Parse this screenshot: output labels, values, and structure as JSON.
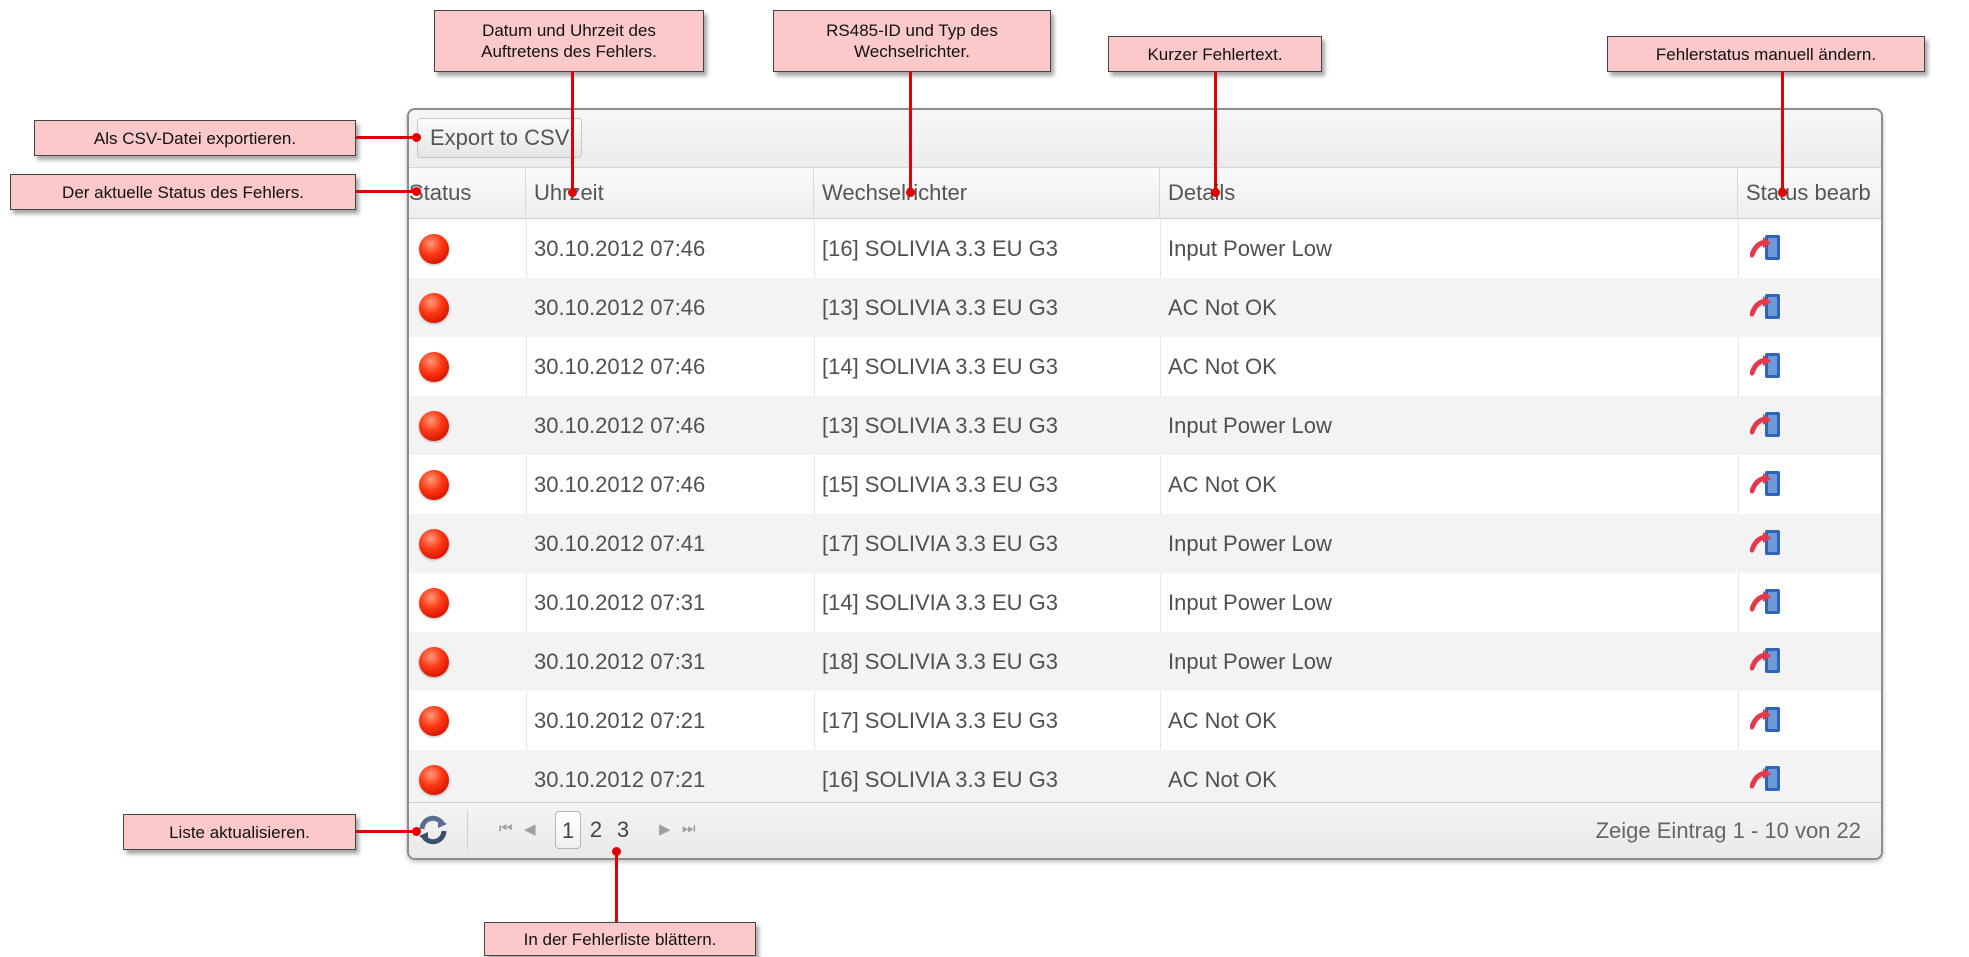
{
  "toolbar": {
    "export_label": "Export to CSV"
  },
  "columns": {
    "status": "Status",
    "time": "Uhrzeit",
    "inverter": "Wechselrichter",
    "details": "Details",
    "edit": "Status bearb"
  },
  "rows": [
    {
      "time": "30.10.2012 07:46",
      "inverter": "[16] SOLIVIA 3.3 EU G3",
      "details": "Input Power Low"
    },
    {
      "time": "30.10.2012 07:46",
      "inverter": "[13] SOLIVIA 3.3 EU G3",
      "details": "AC Not OK"
    },
    {
      "time": "30.10.2012 07:46",
      "inverter": "[14] SOLIVIA 3.3 EU G3",
      "details": "AC Not OK"
    },
    {
      "time": "30.10.2012 07:46",
      "inverter": "[13] SOLIVIA 3.3 EU G3",
      "details": "Input Power Low"
    },
    {
      "time": "30.10.2012 07:46",
      "inverter": "[15] SOLIVIA 3.3 EU G3",
      "details": "AC Not OK"
    },
    {
      "time": "30.10.2012 07:41",
      "inverter": "[17] SOLIVIA 3.3 EU G3",
      "details": "Input Power Low"
    },
    {
      "time": "30.10.2012 07:31",
      "inverter": "[14] SOLIVIA 3.3 EU G3",
      "details": "Input Power Low"
    },
    {
      "time": "30.10.2012 07:31",
      "inverter": "[18] SOLIVIA 3.3 EU G3",
      "details": "Input Power Low"
    },
    {
      "time": "30.10.2012 07:21",
      "inverter": "[17] SOLIVIA 3.3 EU G3",
      "details": "AC Not OK"
    },
    {
      "time": "30.10.2012 07:21",
      "inverter": "[16] SOLIVIA 3.3 EU G3",
      "details": "AC Not OK"
    }
  ],
  "pagination": {
    "pages": [
      "1",
      "2",
      "3"
    ],
    "current_page": "1",
    "info": "Zeige Eintrag 1 - 10 von 22"
  },
  "callouts": {
    "datetime_line1": "Datum und Uhrzeit des",
    "datetime_line2": "Auftretens des Fehlers.",
    "rs485_line1": "RS485-ID und Typ des",
    "rs485_line2": "Wechselrichter.",
    "short_text": "Kurzer Fehlertext.",
    "edit_status": "Fehlerstatus manuell ändern.",
    "export_csv": "Als CSV-Datei exportieren.",
    "current_status": "Der aktuelle Status des Fehlers.",
    "refresh_list": "Liste aktualisieren.",
    "paging": "In der Fehlerliste blättern."
  },
  "colors": {
    "callout_bg": "#fcc9ca",
    "leader_line": "#e00000",
    "status_error": "#ff3a16"
  },
  "icons": {
    "status": "red-error-dot-icon",
    "edit": "edit-status-icon",
    "refresh": "refresh-icon"
  }
}
